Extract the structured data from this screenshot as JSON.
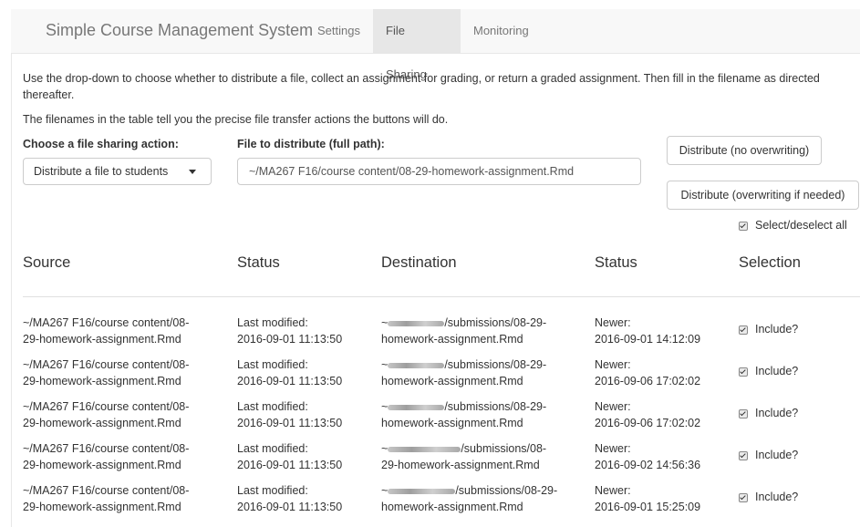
{
  "navbar": {
    "brand": "Simple Course Management System",
    "tabs": [
      {
        "label": "Settings"
      },
      {
        "label": "File Sharing"
      },
      {
        "label": "Monitoring"
      }
    ]
  },
  "intro": {
    "line1": "Use the drop-down to choose whether to distribute a file, collect an assignment for grading, or return a graded assignment. Then fill in the filename as directed",
    "line2": "thereafter.",
    "line3": "The filenames in the table tell you the precise file transfer actions the buttons will do."
  },
  "form": {
    "action_label": "Choose a file sharing action:",
    "action_value": "Distribute a file to students",
    "file_label": "File to distribute (full path):",
    "file_value": "~/MA267 F16/course content/08-29-homework-assignment.Rmd",
    "btn_no_overwrite": "Distribute (no overwriting)",
    "btn_overwrite": "Distribute (overwriting if needed)",
    "select_all": "Select/deselect all"
  },
  "table": {
    "headers": [
      "Source",
      "Status",
      "Destination",
      "Status",
      "Selection"
    ],
    "rows": [
      {
        "src1": "~/MA267 F16/course content/08-",
        "src2": "29-homework-assignment.Rmd",
        "st1": "Last modified:",
        "st2": "2016-09-01 11:13:50",
        "dst1": "~",
        "dst2": "/submissions/08-29-",
        "dst3": "homework-assignment.Rmd",
        "dstat1": "Newer:",
        "dstat2": "2016-09-01 14:12:09",
        "sel": "Include?"
      },
      {
        "src1": "~/MA267 F16/course content/08-",
        "src2": "29-homework-assignment.Rmd",
        "st1": "Last modified:",
        "st2": "2016-09-01 11:13:50",
        "dst1": "~",
        "dst2": "/submissions/08-29-",
        "dst3": "homework-assignment.Rmd",
        "dstat1": "Newer:",
        "dstat2": "2016-09-06 17:02:02",
        "sel": "Include?"
      },
      {
        "src1": "~/MA267 F16/course content/08-",
        "src2": "29-homework-assignment.Rmd",
        "st1": "Last modified:",
        "st2": "2016-09-01 11:13:50",
        "dst1": "~",
        "dst2": "/submissions/08-29-",
        "dst3": "homework-assignment.Rmd",
        "dstat1": "Newer:",
        "dstat2": "2016-09-06 17:02:02",
        "sel": "Include?"
      },
      {
        "src1": "~/MA267 F16/course content/08-",
        "src2": "29-homework-assignment.Rmd",
        "st1": "Last modified:",
        "st2": "2016-09-01 11:13:50",
        "dst1": "~",
        "dst2": "/submissions/08-",
        "dst3": "29-homework-assignment.Rmd",
        "dstat1": "Newer:",
        "dstat2": "2016-09-02 14:56:36",
        "sel": "Include?"
      },
      {
        "src1": "~/MA267 F16/course content/08-",
        "src2": "29-homework-assignment.Rmd",
        "st1": "Last modified:",
        "st2": "2016-09-01 11:13:50",
        "dst1": "~",
        "dst2": "/submissions/08-29-",
        "dst3": "homework-assignment.Rmd",
        "dstat1": "Newer:",
        "dstat2": "2016-09-01 15:25:09",
        "sel": "Include?"
      }
    ]
  }
}
